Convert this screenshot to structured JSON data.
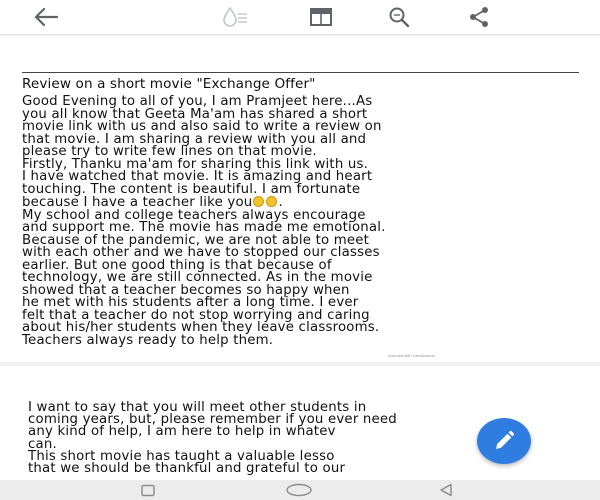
{
  "toolbar": {
    "icons": [
      "back-arrow-icon",
      "reading-mode-icon",
      "page-layout-icon",
      "search-icon",
      "share-icon"
    ]
  },
  "document": {
    "title": "Review on a short movie \"Exchange Offer\"",
    "page1_lines": [
      "Good Evening to all of you, I am Pramjeet here...As",
      "you all know that Geeta Ma'am has shared a short",
      "movie link with us and also said to write a review on",
      "that movie. I am sharing a review with you all and",
      "please try to write few lines on that movie.",
      "Firstly, Thanku ma'am for sharing this link with us.",
      "I have watched that movie. It is amazing and heart",
      "touching. The content is beautiful. I am fortunate",
      "because I have a teacher like you",
      "My school and college teachers always encourage",
      "and support me. The movie has made me emotional.",
      "Because of the pandemic, we are not able to meet",
      "with each other and we have to stopped our classes",
      "earlier. But one good thing is that because of",
      "technology, we are still connected. As in the movie",
      "showed that a teacher becomes so happy when",
      "he met with his students after a long time. I ever",
      "felt that a teacher do not stop worrying and caring",
      "about his/her students when they leave classrooms.",
      "Teachers always ready to help them."
    ],
    "emoji_line_suffix": ".",
    "scanner_mark": "Scanned with CamScanner",
    "page2_lines": [
      "I want to say that you will meet other students in",
      "coming years, but, please remember if you ever need",
      "any kind of help, I am here to help in whatev",
      "can.",
      "This short movie has taught a valuable lesso",
      "that we should be thankful and grateful to our"
    ]
  },
  "fab": {
    "icon": "pencil-icon"
  },
  "navbar": {
    "icons": [
      "recent-apps-icon",
      "home-icon",
      "back-triangle-icon"
    ]
  },
  "colors": {
    "fab_blue": "#2f7de1",
    "toolbar_icon": "#5f6368",
    "page_background": "#ffffff",
    "viewer_background": "#f1f1f1"
  }
}
